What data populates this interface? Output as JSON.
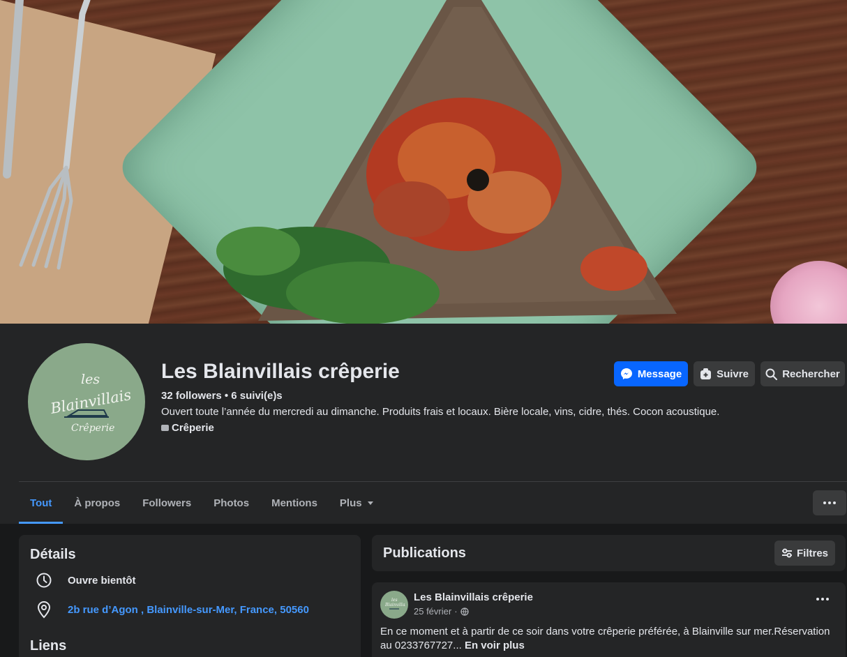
{
  "page": {
    "name": "Les Blainvillais crêperie",
    "counts": "32 followers • 6 suivi(e)s",
    "bio": "Ouvert toute l’année du mercredi au dimanche. Produits frais et locaux. Bière locale, vins, cidre, thés. Cocon acoustique.",
    "category": "Crêperie",
    "logo": {
      "line1": "les",
      "line2": "Blainvillais",
      "line3": "Crêperie"
    }
  },
  "actions": {
    "message": "Message",
    "follow": "Suivre",
    "search": "Rechercher"
  },
  "tabs": [
    {
      "label": "Tout",
      "active": true
    },
    {
      "label": "À propos"
    },
    {
      "label": "Followers"
    },
    {
      "label": "Photos"
    },
    {
      "label": "Mentions"
    },
    {
      "label": "Plus"
    }
  ],
  "details": {
    "title": "Détails",
    "hours": "Ouvre bientôt",
    "address": "2b rue d’Agon , Blainville-sur-Mer, France, 50560",
    "links_title": "Liens"
  },
  "publications": {
    "title": "Publications",
    "filter": "Filtres"
  },
  "post": {
    "author": "Les Blainvillais crêperie",
    "date": "25 février",
    "text": "En ce moment et à partir de ce soir dans votre crêperie préférée, à Blainville sur mer.Réservation au 0233767727...",
    "see_more": "En voir plus"
  },
  "colors": {
    "accent": "#0866ff",
    "active_tab": "#4599ff",
    "link": "#4599ff",
    "card": "#242526",
    "background": "#18191a"
  }
}
